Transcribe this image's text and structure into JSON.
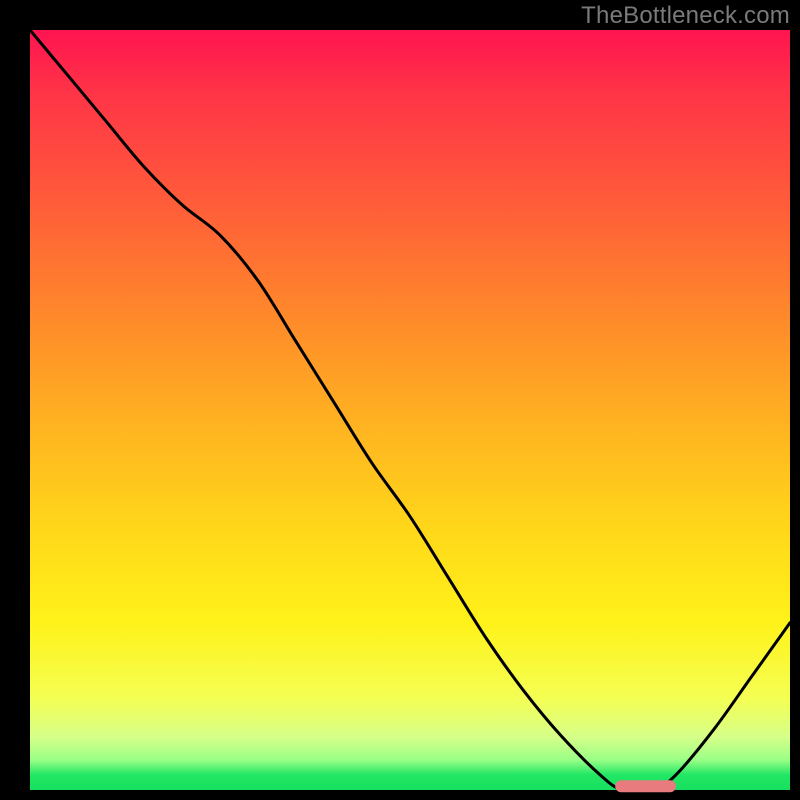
{
  "watermark": "TheBottleneck.com",
  "chart_data": {
    "type": "line",
    "title": "",
    "xlabel": "",
    "ylabel": "",
    "xlim": [
      0,
      100
    ],
    "ylim": [
      0,
      100
    ],
    "grid": false,
    "legend": false,
    "background_gradient": {
      "stops": [
        {
          "pct": 0,
          "color": "#ff1450"
        },
        {
          "pct": 8,
          "color": "#ff3347"
        },
        {
          "pct": 22,
          "color": "#ff5a3a"
        },
        {
          "pct": 38,
          "color": "#ff8a2a"
        },
        {
          "pct": 52,
          "color": "#ffb321"
        },
        {
          "pct": 66,
          "color": "#ffd81a"
        },
        {
          "pct": 78,
          "color": "#fff21a"
        },
        {
          "pct": 88,
          "color": "#f4ff54"
        },
        {
          "pct": 93,
          "color": "#d6ff88"
        },
        {
          "pct": 96,
          "color": "#9bff87"
        },
        {
          "pct": 98,
          "color": "#23e765"
        },
        {
          "pct": 100,
          "color": "#15e05e"
        }
      ]
    },
    "series": [
      {
        "name": "bottleneck-curve",
        "color": "#000000",
        "x": [
          0,
          5,
          10,
          15,
          20,
          25,
          30,
          35,
          40,
          45,
          50,
          55,
          60,
          65,
          70,
          75,
          78,
          82,
          85,
          90,
          95,
          100
        ],
        "y": [
          100,
          94,
          88,
          82,
          77,
          73,
          67,
          59,
          51,
          43,
          36,
          28,
          20,
          13,
          7,
          2,
          0,
          0,
          2,
          8,
          15,
          22
        ]
      }
    ],
    "marker": {
      "name": "optimal-range",
      "color": "#e77b7e",
      "shape": "rounded-bar",
      "x_start": 77,
      "x_end": 85,
      "y": 0.5
    }
  }
}
